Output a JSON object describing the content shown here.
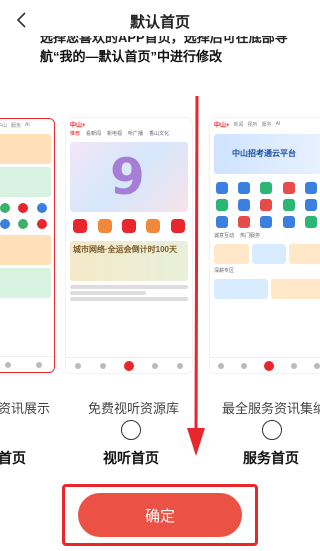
{
  "header": {
    "title": "默认首页"
  },
  "description": {
    "line1_clipped": "选择您喜欢的APP首页，选择后可在底部导",
    "line2_prefix": "航",
    "line2_highlight": "“我的—默认首页”",
    "line2_suffix": "中进行修改"
  },
  "preview_cards": [
    {
      "name": "news",
      "tabs": [
        "中山",
        "服务",
        "AI"
      ]
    },
    {
      "name": "audiovisual",
      "tabs": [
        "推荐",
        "看新闻",
        "新电视",
        "听广播",
        "香山文化"
      ],
      "banner_text": "9",
      "promo_text": "城市网络·全运会倒计时100天"
    },
    {
      "name": "service",
      "tabs": [
        "新闻",
        "视听",
        "服务",
        "AI"
      ],
      "banner_text": "中山招考通云平台",
      "section_labels": [
        "诚意互动",
        "热门服务",
        "深耕专区"
      ]
    }
  ],
  "options": [
    {
      "description": "资讯展示",
      "label": "首页"
    },
    {
      "description": "免费视听资源库",
      "label": "视听首页"
    },
    {
      "description": "最全服务资讯集纳",
      "label": "服务首页"
    }
  ],
  "colors": {
    "accent": "#e8262b",
    "button": "#ec5146"
  },
  "confirm": {
    "label": "确定"
  }
}
